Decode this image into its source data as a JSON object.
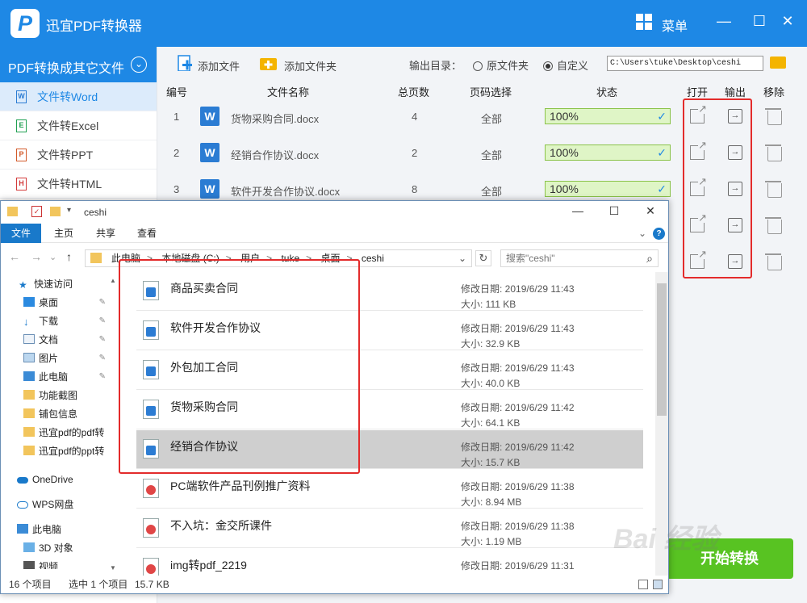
{
  "app": {
    "logo": "P",
    "title": "迅宜PDF转换器",
    "menu_label": "菜单",
    "win_min": "—",
    "win_max": "☐",
    "win_close": "✕"
  },
  "sidebar": {
    "head": "PDF转换成其它文件",
    "items": [
      {
        "label": "文件转Word",
        "icon": "W",
        "color": "#2b7cd3"
      },
      {
        "label": "文件转Excel",
        "icon": "E",
        "color": "#20a052"
      },
      {
        "label": "文件转PPT",
        "icon": "P",
        "color": "#d35b2b"
      },
      {
        "label": "文件转HTML",
        "icon": "H",
        "color": "#d33b3b"
      }
    ]
  },
  "toolbar": {
    "add_file": "添加文件",
    "add_folder": "添加文件夹",
    "output_label": "输出目录：",
    "opt_source": "原文件夹",
    "opt_custom": "自定义",
    "output_path": "C:\\Users\\tuke\\Desktop\\ceshi"
  },
  "table": {
    "headers": {
      "num": "编号",
      "name": "文件名称",
      "pages": "总页数",
      "range": "页码选择",
      "status": "状态",
      "open": "打开",
      "output": "输出",
      "remove": "移除"
    },
    "rows": [
      {
        "num": "1",
        "name": "货物采购合同.docx",
        "pages": "4",
        "range": "全部",
        "status": "100%"
      },
      {
        "num": "2",
        "name": "经销合作协议.docx",
        "pages": "2",
        "range": "全部",
        "status": "100%"
      },
      {
        "num": "3",
        "name": "软件开发合作协议.docx",
        "pages": "8",
        "range": "全部",
        "status": "100%"
      }
    ],
    "word_icon": "W",
    "out_icon": "→"
  },
  "start_button": "开始转换",
  "explorer": {
    "title": "ceshi",
    "win_min": "—",
    "win_max": "☐",
    "win_close": "✕",
    "ribbon": {
      "file": "文件",
      "home": "主页",
      "share": "共享",
      "view": "查看",
      "expand": "⌄",
      "help": "?"
    },
    "nav": {
      "back": "←",
      "forward": "→",
      "recent": "⌄",
      "up": "↑"
    },
    "breadcrumb": [
      "此电脑",
      "本地磁盘 (C:)",
      "用户",
      "tuke",
      "桌面",
      "ceshi"
    ],
    "crumb_sep": ">",
    "addr_dropdown": "⌄",
    "refresh": "↻",
    "search_placeholder": "搜索\"ceshi\"",
    "search_icon": "⌕",
    "nav_pane": [
      {
        "label": "快速访问",
        "type": "star",
        "pinned": false
      },
      {
        "label": "桌面",
        "type": "desktop",
        "pinned": true
      },
      {
        "label": "下载",
        "type": "download",
        "pinned": true
      },
      {
        "label": "文档",
        "type": "doc",
        "pinned": true
      },
      {
        "label": "图片",
        "type": "pic",
        "pinned": true
      },
      {
        "label": "此电脑",
        "type": "pc",
        "pinned": true
      },
      {
        "label": "功能截图",
        "type": "folder",
        "pinned": false
      },
      {
        "label": "铺包信息",
        "type": "folder",
        "pinned": false
      },
      {
        "label": "迅宜pdf的pdf转",
        "type": "folder",
        "pinned": false
      },
      {
        "label": "迅宜pdf的ppt转",
        "type": "folder",
        "pinned": false
      },
      {
        "label": "OneDrive",
        "type": "cloud",
        "pinned": false
      },
      {
        "label": "WPS网盘",
        "type": "wps",
        "pinned": false
      },
      {
        "label": "此电脑",
        "type": "pc",
        "pinned": false
      },
      {
        "label": "3D 对象",
        "type": "cube",
        "pinned": false
      },
      {
        "label": "视频",
        "type": "video",
        "pinned": false
      }
    ],
    "pin_icon": "📌",
    "files": [
      {
        "name": "商品买卖合同",
        "date": "修改日期: 2019/6/29 11:43",
        "size": "大小: 111 KB",
        "kind": "word"
      },
      {
        "name": "软件开发合作协议",
        "date": "修改日期: 2019/6/29 11:43",
        "size": "大小: 32.9 KB",
        "kind": "word"
      },
      {
        "name": "外包加工合同",
        "date": "修改日期: 2019/6/29 11:43",
        "size": "大小: 40.0 KB",
        "kind": "word"
      },
      {
        "name": "货物采购合同",
        "date": "修改日期: 2019/6/29 11:42",
        "size": "大小: 64.1 KB",
        "kind": "word"
      },
      {
        "name": "经销合作协议",
        "date": "修改日期: 2019/6/29 11:42",
        "size": "大小: 15.7 KB",
        "kind": "word",
        "selected": true
      },
      {
        "name": "PC端软件产品刊例推广资料",
        "date": "修改日期: 2019/6/29 11:38",
        "size": "大小: 8.94 MB",
        "kind": "pdf"
      },
      {
        "name": "不入坑：金交所课件",
        "date": "修改日期: 2019/6/29 11:38",
        "size": "大小: 1.19 MB",
        "kind": "pdf"
      },
      {
        "name": "img转pdf_2219",
        "date": "修改日期: 2019/6/29 11:31",
        "size": "",
        "kind": "pdf"
      }
    ],
    "status": {
      "count": "16 个项目",
      "selected": "选中 1 个项目",
      "size": "15.7 KB"
    }
  },
  "watermark": "Bai 经验",
  "colors": {
    "accent": "#1e88e5",
    "highlight_box": "#e32b2b",
    "start_green": "#58c322",
    "progress_fill": "#dff5c6"
  }
}
